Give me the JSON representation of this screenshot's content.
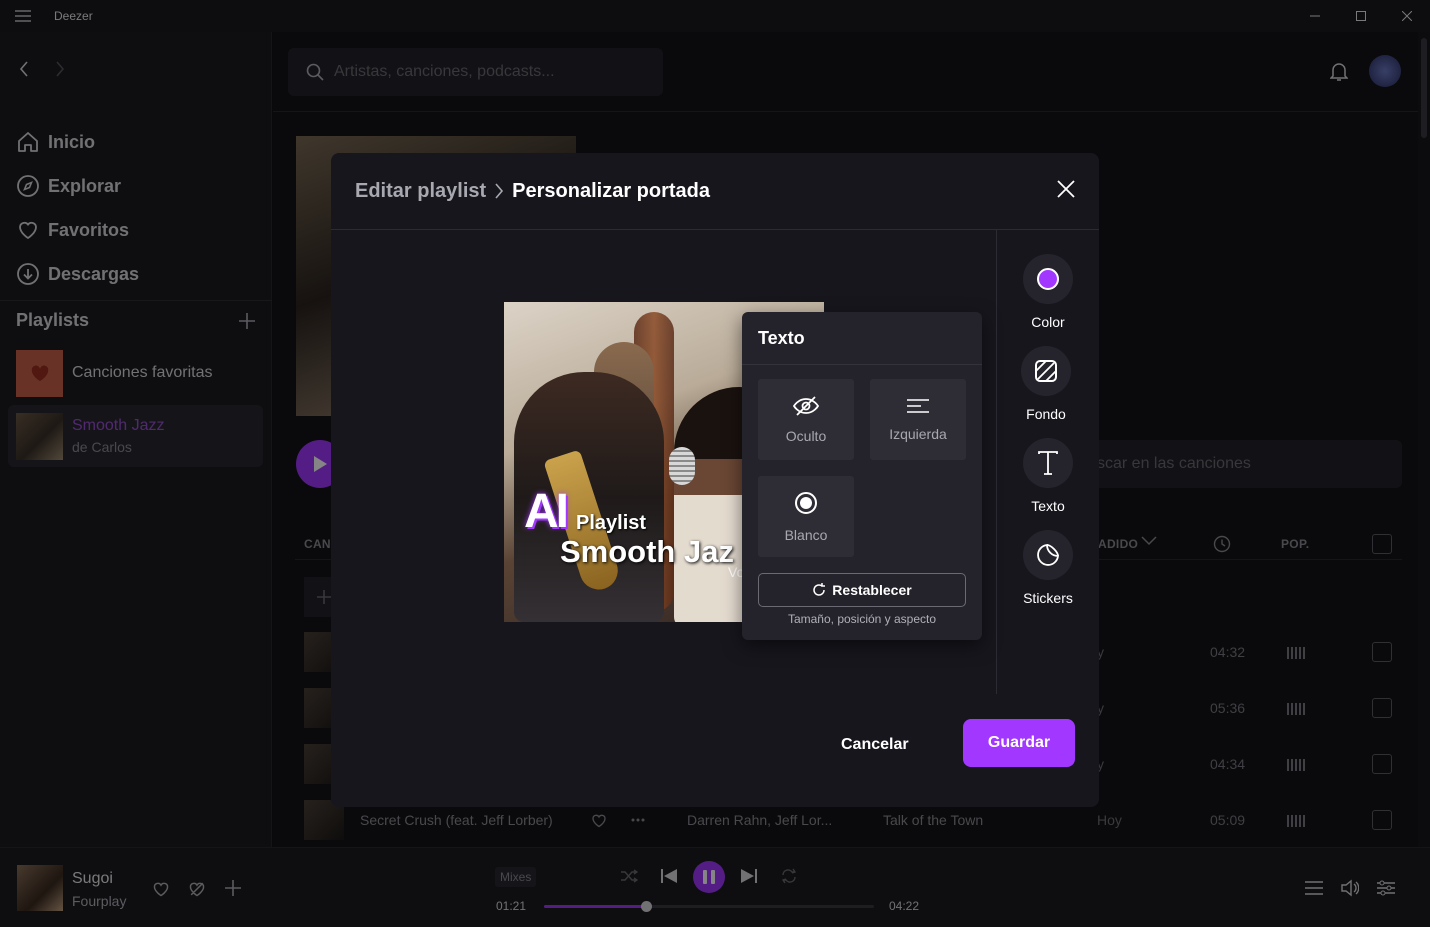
{
  "window": {
    "title": "Deezer"
  },
  "sidebar": {
    "nav": [
      {
        "label": "Inicio",
        "icon": "home-icon"
      },
      {
        "label": "Explorar",
        "icon": "compass-icon"
      },
      {
        "label": "Favoritos",
        "icon": "heart-icon"
      },
      {
        "label": "Descargas",
        "icon": "download-icon"
      }
    ],
    "playlists_header": "Playlists",
    "playlists": [
      {
        "title": "Canciones favoritas",
        "subtitle": ""
      },
      {
        "title": "Smooth Jazz",
        "subtitle": "de Carlos"
      }
    ]
  },
  "topbar": {
    "search_placeholder": "Artistas, canciones, podcasts..."
  },
  "playlist_page": {
    "track_search_placeholder": "scar en las canciones",
    "columns": {
      "song": "CAN",
      "added": "ADIDO",
      "pop": "POP."
    },
    "rows": [
      {
        "day": "y",
        "duration": "04:32"
      },
      {
        "day": "y",
        "duration": "05:36"
      },
      {
        "day": "y",
        "duration": "04:34"
      },
      {
        "title": "Secret Crush (feat. Jeff Lorber)",
        "artist": "Darren Rahn, Jeff Lor...",
        "album": "Talk of the Town",
        "day": "Hoy",
        "duration": "05:09"
      }
    ]
  },
  "modal": {
    "breadcrumb_parent": "Editar playlist",
    "breadcrumb_current": "Personalizar portada",
    "cover": {
      "text_ai": "AI",
      "text_playlist": "Playlist",
      "text_title": "Smooth Jaz",
      "text_vol": "Vo"
    },
    "text_panel": {
      "title": "Texto",
      "options": [
        {
          "label": "Oculto",
          "icon": "eye-off-icon"
        },
        {
          "label": "Izquierda",
          "icon": "align-left-icon"
        },
        {
          "label": "Blanco",
          "icon": "radio-selected-icon"
        }
      ],
      "reset_label": "Restablecer",
      "reset_hint": "Tamaño, posición y aspecto"
    },
    "tools": [
      {
        "label": "Color",
        "icon": "color-dot-icon"
      },
      {
        "label": "Fondo",
        "icon": "background-pattern-icon"
      },
      {
        "label": "Texto",
        "icon": "text-icon"
      },
      {
        "label": "Stickers",
        "icon": "sticker-icon"
      }
    ],
    "cancel_label": "Cancelar",
    "save_label": "Guardar"
  },
  "player": {
    "track_title": "Sugoi",
    "track_artist": "Fourplay",
    "mixes_label": "Mixes",
    "elapsed": "01:21",
    "total": "04:22",
    "progress_fraction": 0.31
  },
  "colors": {
    "accent": "#a238ff",
    "background": "#141418",
    "modal": "#17161d"
  }
}
